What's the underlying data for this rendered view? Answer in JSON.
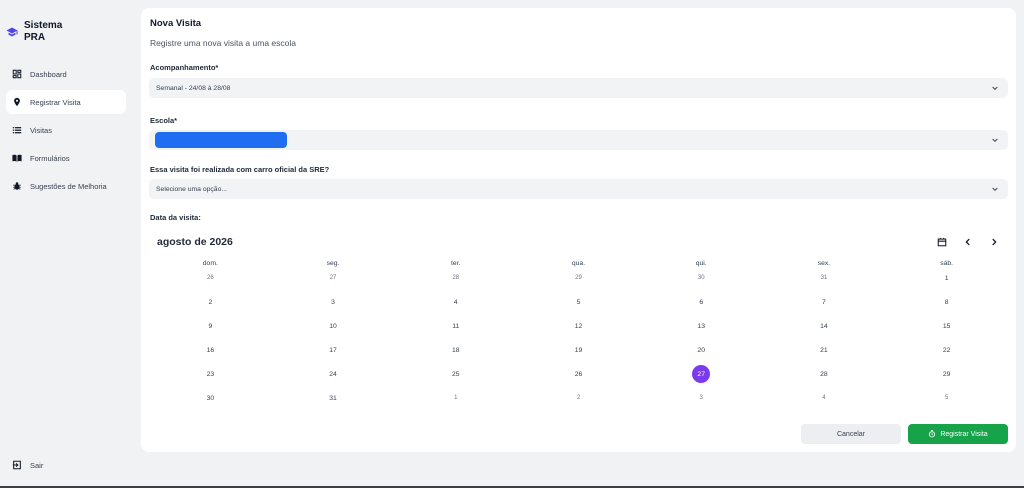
{
  "app": {
    "title_line1": "Sistema",
    "title_line2": "PRA"
  },
  "sidebar": {
    "items": [
      {
        "label": "Dashboard",
        "icon": "dashboard-icon",
        "active": false
      },
      {
        "label": "Registrar Visita",
        "icon": "map-pin-icon",
        "active": true
      },
      {
        "label": "Visitas",
        "icon": "list-icon",
        "active": false
      },
      {
        "label": "Formulários",
        "icon": "book-icon",
        "active": false
      },
      {
        "label": "Sugestões de Melhoria",
        "icon": "bug-icon",
        "active": false
      }
    ],
    "logout_label": "Sair"
  },
  "page": {
    "title": "Nova Visita",
    "subtitle": "Registre uma nova visita a uma escola"
  },
  "form": {
    "acompanhamento_label": "Acompanhamento*",
    "acompanhamento_value": "Semanal - 24/08 à 28/08",
    "escola_label": "Escola*",
    "carro_label": "Essa visita foi realizada com carro oficial da SRE?",
    "carro_placeholder": "Selecione uma opção...",
    "data_label": "Data da visita:"
  },
  "calendar": {
    "month_label": "agosto de 2026",
    "weekdays": [
      "dom.",
      "seg.",
      "ter.",
      "qua.",
      "qui.",
      "sex.",
      "sáb."
    ],
    "weeks": [
      [
        "26",
        "27",
        "28",
        "29",
        "30",
        "31",
        "1"
      ],
      [
        "2",
        "3",
        "4",
        "5",
        "6",
        "7",
        "8"
      ],
      [
        "9",
        "10",
        "11",
        "12",
        "13",
        "14",
        "15"
      ],
      [
        "16",
        "17",
        "18",
        "19",
        "20",
        "21",
        "22"
      ],
      [
        "23",
        "24",
        "25",
        "26",
        "27",
        "28",
        "29"
      ],
      [
        "30",
        "31",
        "1",
        "2",
        "3",
        "4",
        "5"
      ]
    ],
    "selected_day": "27"
  },
  "actions": {
    "cancel_label": "Cancelar",
    "submit_label": "Registrar Visita"
  },
  "colors": {
    "accent_purple": "#7c3aed",
    "submit_green": "#16a34a",
    "redaction_blue": "#1f6ef2"
  }
}
